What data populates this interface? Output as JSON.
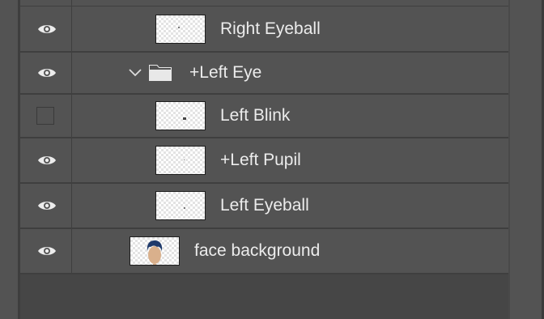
{
  "layers": [
    {
      "name": "Right Eyeball",
      "visible": true,
      "type": "layer"
    },
    {
      "name": "+Left Eye",
      "visible": true,
      "type": "group",
      "expanded": true
    },
    {
      "name": "Left Blink",
      "visible": false,
      "type": "layer"
    },
    {
      "name": "+Left Pupil",
      "visible": true,
      "type": "layer"
    },
    {
      "name": "Left Eyeball",
      "visible": true,
      "type": "layer"
    },
    {
      "name": "face background",
      "visible": true,
      "type": "layer"
    }
  ],
  "colors": {
    "panel_bg": "#535353",
    "row_separator": "#3f3f3f",
    "text": "#ececec",
    "face_skin": "#d9b08c",
    "face_hair": "#1f3a6b"
  }
}
